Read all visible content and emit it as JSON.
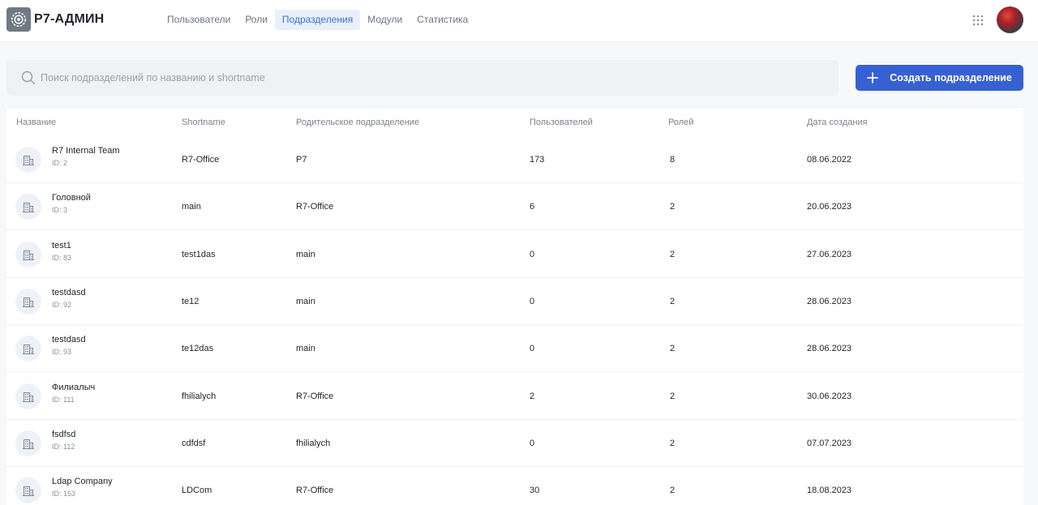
{
  "app": {
    "logo_text": "Р7-АДМИН"
  },
  "nav": {
    "items": [
      {
        "label": "Пользователи",
        "active": false
      },
      {
        "label": "Роли",
        "active": false
      },
      {
        "label": "Подразделения",
        "active": true
      },
      {
        "label": "Модули",
        "active": false
      },
      {
        "label": "Статистика",
        "active": false
      }
    ]
  },
  "search": {
    "placeholder": "Поиск подразделений по названию и shortname",
    "value": ""
  },
  "create_button": {
    "label": "Создать подразделение"
  },
  "colors": {
    "accent": "#3561d3",
    "nav_active_bg": "#e8f0fb",
    "nav_active_text": "#3d6fd1"
  },
  "icons": {
    "logo": "gear-logo-icon",
    "apps": "grid-icon",
    "search": "search-icon",
    "create": "plus-icon",
    "row": "building-icon"
  },
  "table": {
    "headers": [
      "Название",
      "Shortname",
      "Родительское подразделение",
      "Пользователей",
      "Ролей",
      "Дата создания"
    ],
    "rows": [
      {
        "name": "R7 Internal Team",
        "id": "ID: 2",
        "shortname": "R7-Office",
        "parent": "Р7",
        "users": "173",
        "roles": "8",
        "date": "08.06.2022"
      },
      {
        "name": "Головной",
        "id": "ID: 3",
        "shortname": "main",
        "parent": "R7-Office",
        "users": "6",
        "roles": "2",
        "date": "20.06.2023"
      },
      {
        "name": "test1",
        "id": "ID: 83",
        "shortname": "test1das",
        "parent": "main",
        "users": "0",
        "roles": "2",
        "date": "27.06.2023"
      },
      {
        "name": "testdasd",
        "id": "ID: 92",
        "shortname": "te12",
        "parent": "main",
        "users": "0",
        "roles": "2",
        "date": "28.06.2023"
      },
      {
        "name": "testdasd",
        "id": "ID: 93",
        "shortname": "te12das",
        "parent": "main",
        "users": "0",
        "roles": "2",
        "date": "28.06.2023"
      },
      {
        "name": "Филиалыч",
        "id": "ID: 111",
        "shortname": "fhilialych",
        "parent": "R7-Office",
        "users": "2",
        "roles": "2",
        "date": "30.06.2023"
      },
      {
        "name": "fsdfsd",
        "id": "ID: 112",
        "shortname": "cdfdsf",
        "parent": "fhilialych",
        "users": "0",
        "roles": "2",
        "date": "07.07.2023"
      },
      {
        "name": "Ldap Company",
        "id": "ID: 153",
        "shortname": "LDCom",
        "parent": "R7-Office",
        "users": "30",
        "roles": "2",
        "date": "18.08.2023"
      }
    ]
  }
}
